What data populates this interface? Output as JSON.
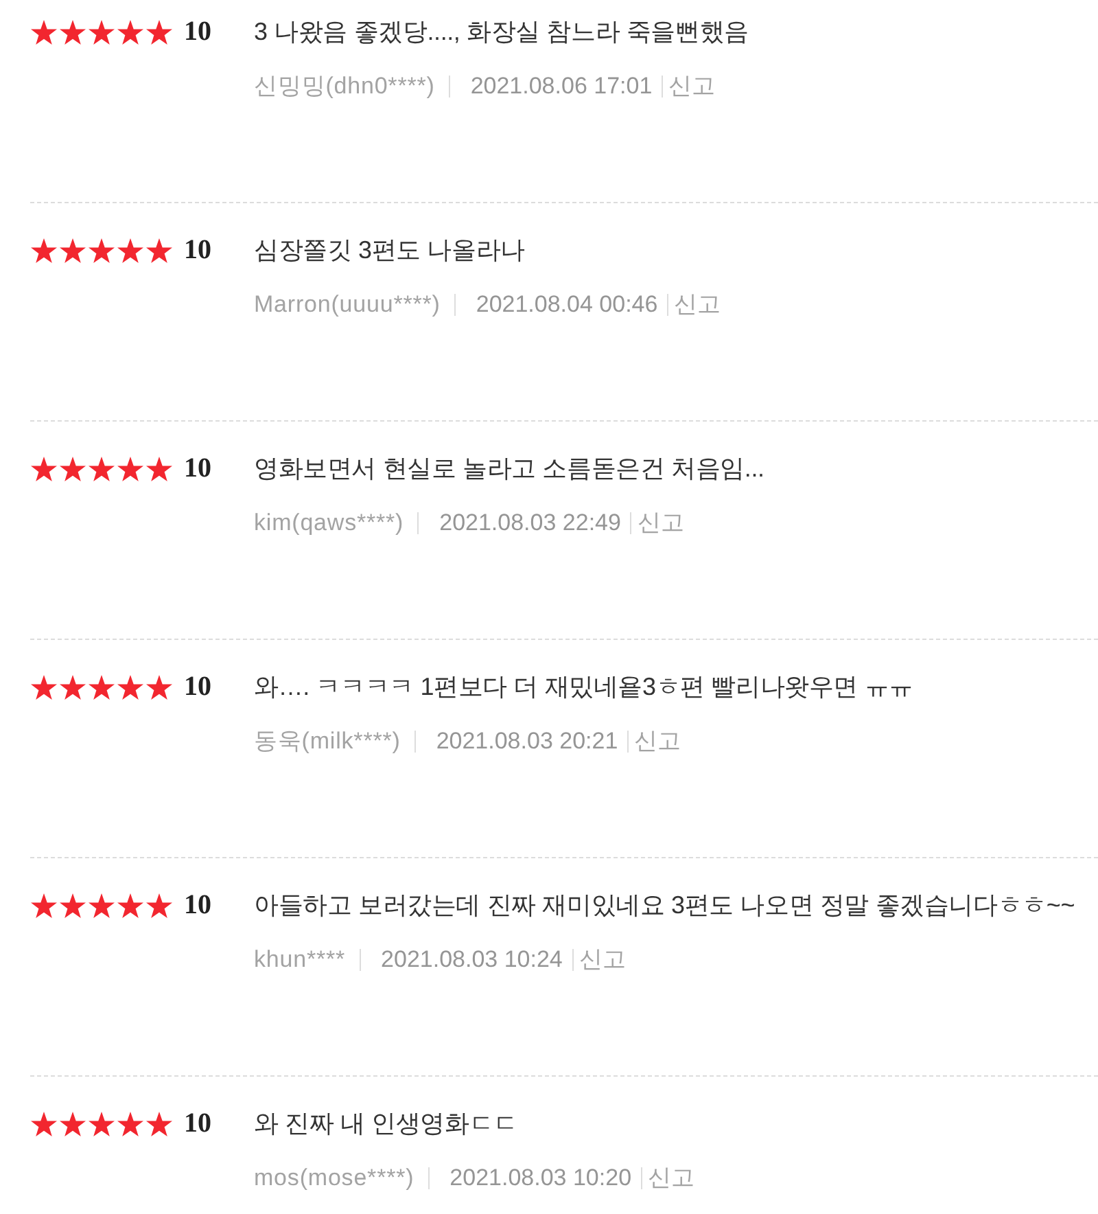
{
  "reviews": [
    {
      "stars": 5,
      "score": "10",
      "comment": "3 나왔음 좋겠당...., 화장실 참느라 죽을뻔했음",
      "author": "신밍밍(dhn0****)",
      "date": "2021.08.06 17:01",
      "report": "신고"
    },
    {
      "stars": 5,
      "score": "10",
      "comment": "심장쫄깃 3편도 나올라나",
      "author": "Marron(uuuu****)",
      "date": "2021.08.04 00:46",
      "report": "신고"
    },
    {
      "stars": 5,
      "score": "10",
      "comment": "영화보면서 현실로 놀라고 소름돋은건 처음임...",
      "author": "kim(qaws****)",
      "date": "2021.08.03 22:49",
      "report": "신고"
    },
    {
      "stars": 5,
      "score": "10",
      "comment": "와…. ㅋㅋㅋㅋ 1편보다 더 재밌네욭3ㅎ편 빨리나왓우면 ㅠㅠ",
      "author": "동욱(milk****)",
      "date": "2021.08.03 20:21",
      "report": "신고"
    },
    {
      "stars": 5,
      "score": "10",
      "comment": "아들하고 보러갔는데 진짜 재미있네요 3편도 나오면 정말 좋겠습니다ㅎㅎ~~",
      "author": "khun****",
      "date": "2021.08.03 10:24",
      "report": "신고"
    },
    {
      "stars": 5,
      "score": "10",
      "comment": "와 진짜 내 인생영화ㄷㄷ",
      "author": "mos(mose****)",
      "date": "2021.08.03 10:20",
      "report": "신고"
    }
  ]
}
